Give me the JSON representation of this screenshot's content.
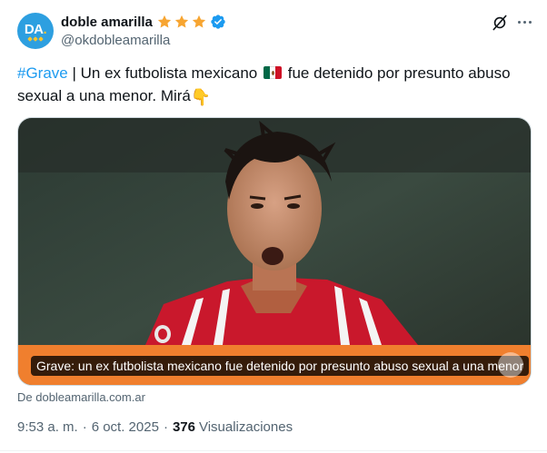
{
  "author": {
    "display_name": "doble amarilla",
    "handle": "@okdobleamarilla",
    "avatar_text": "DA",
    "avatar_color": "#2d9fe0",
    "verified_color": "#1d9bf0",
    "badge_star_color": "#f7a531"
  },
  "tweet": {
    "hashtag": "#Grave",
    "text_part1": " | Un ex futbolista mexicano ",
    "text_part2": " fue detenido por presunto abuso sexual a una menor. Mirá"
  },
  "card": {
    "caption": "Grave: un ex futbolista mexicano fue detenido por presunto abuso sexual a una menor",
    "source": "De dobleamarilla.com.ar",
    "band_color": "#f07f2e"
  },
  "meta": {
    "time": "9:53 a. m.",
    "separator": "·",
    "date": "6 oct. 2025",
    "views_count": "376",
    "views_label": "Visualizaciones"
  },
  "colors": {
    "text_primary": "#0f1419",
    "text_secondary": "#536471",
    "link": "#1d9bf0"
  }
}
